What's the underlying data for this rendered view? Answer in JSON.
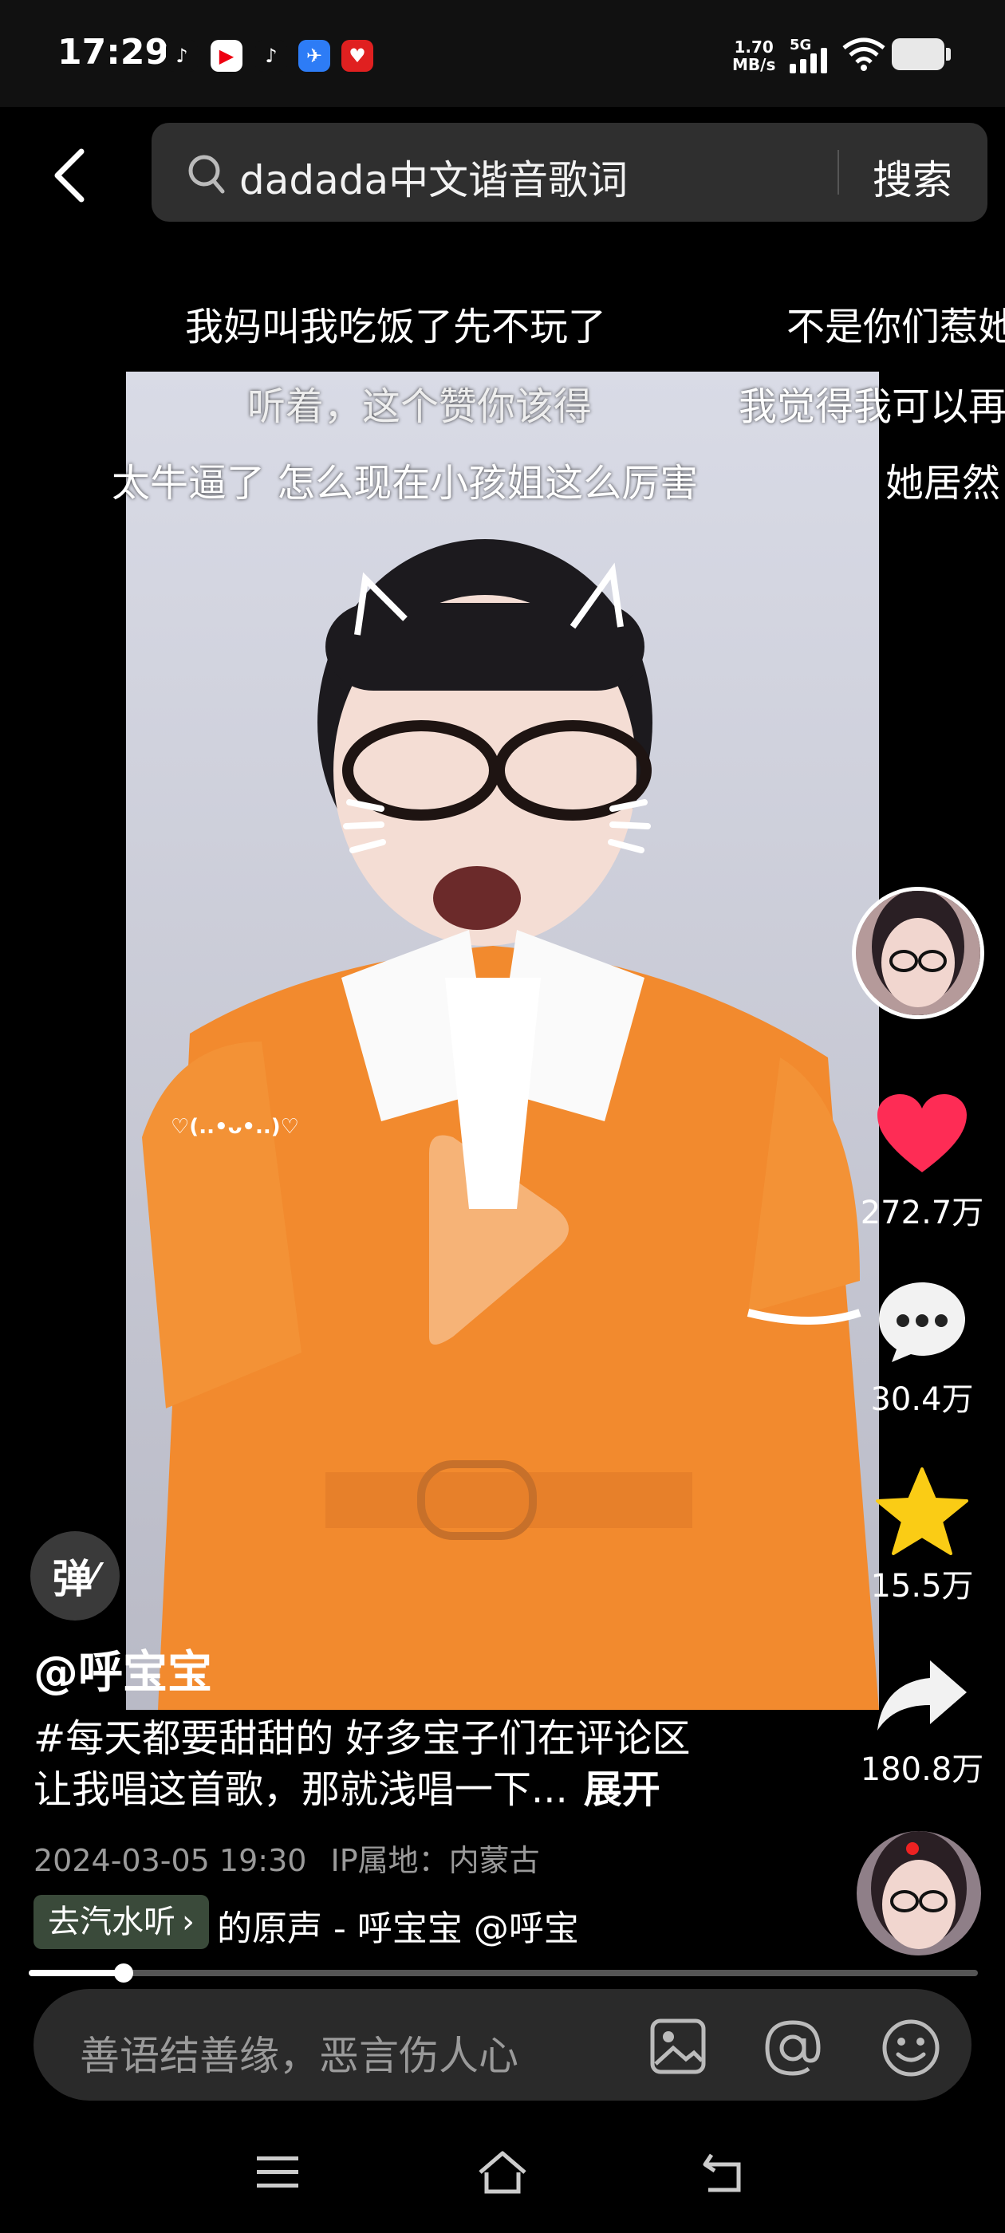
{
  "status_bar": {
    "time": "17:29",
    "net_speed_value": "1.70",
    "net_speed_unit": "MB/s",
    "signal_label": "5G"
  },
  "search": {
    "query": "dadada中文谐音歌词",
    "button_label": "搜索"
  },
  "danmaku": [
    {
      "text": "我妈叫我吃饭了先不玩了"
    },
    {
      "text": "不是你们惹她"
    },
    {
      "text": "听着，这个赞你该得"
    },
    {
      "text": "我觉得我可以再"
    },
    {
      "text": "太牛逼了 怎么现在小孩姐这么厉害"
    },
    {
      "text": "她居然"
    }
  ],
  "video": {
    "overlay_text": "♡(..•ᴗ•..)♡"
  },
  "actions": {
    "likes": "272.7万",
    "comments": "30.4万",
    "favorites": "15.5万",
    "shares": "180.8万"
  },
  "post": {
    "danmaku_toggle": "弹",
    "author": "@呼宝宝",
    "description_line1": "#每天都要甜甜的 好多宝子们在评论区",
    "description_line2": "让我唱这首歌，那就浅唱一下...",
    "expand_label": "展开",
    "date": "2024-03-05 19:30",
    "ip_location": "IP属地：内蒙古",
    "music_tag": "去汽水听",
    "music_text": "的原声 - 呼宝宝    @呼宝"
  },
  "playback": {
    "progress": 0.1
  },
  "comment": {
    "placeholder": "善语结善缘，恶言伤人心"
  },
  "colors": {
    "like": "#fe2c55",
    "favorite": "#facc15"
  }
}
